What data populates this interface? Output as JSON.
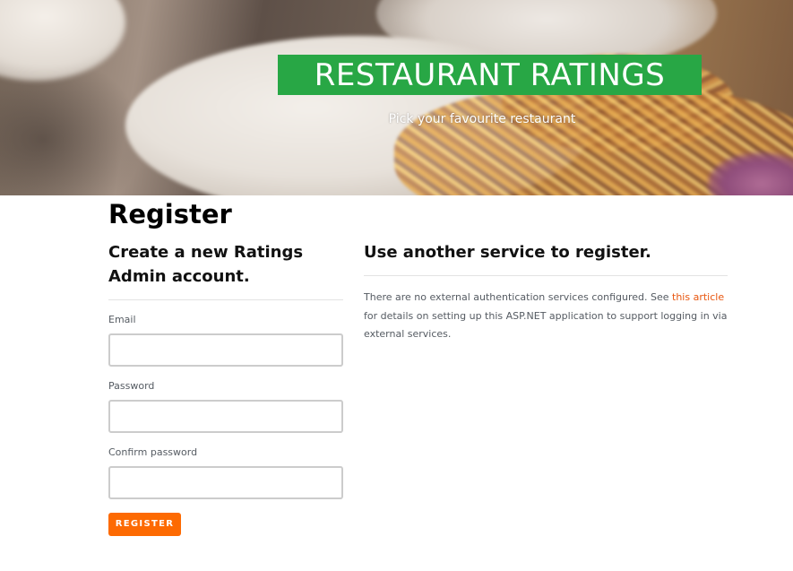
{
  "hero": {
    "title": "RESTAURANT RATINGS",
    "subtitle": "Pick your favourite restaurant",
    "title_bg_color": "#28a745"
  },
  "page": {
    "heading": "Register"
  },
  "register_form": {
    "heading": "Create a new Ratings Admin account.",
    "fields": [
      {
        "label": "Email",
        "value": "",
        "placeholder": ""
      },
      {
        "label": "Password",
        "value": "",
        "placeholder": ""
      },
      {
        "label": "Confirm password",
        "value": "",
        "placeholder": ""
      }
    ],
    "submit_label": "REGISTER",
    "submit_color": "#fd6a02"
  },
  "external_services": {
    "heading": "Use another service to register.",
    "text_before_link": "There are no external authentication services configured. See ",
    "link_text": "this article",
    "text_after_link": " for details on setting up this ASP.NET application to support logging in via external services.",
    "link_color": "#e8560f"
  }
}
